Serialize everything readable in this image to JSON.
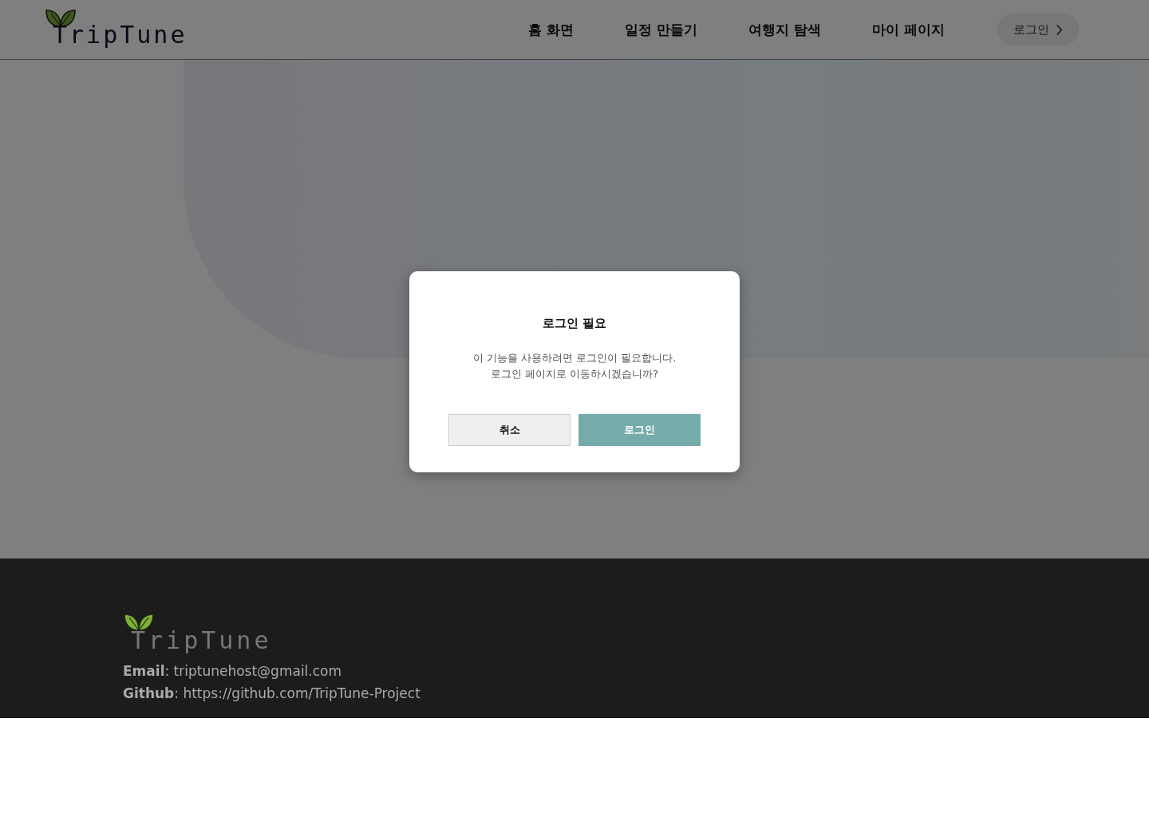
{
  "header": {
    "logo": "TripTune",
    "nav": [
      "홈 화면",
      "일정 만들기",
      "여행지 탐색",
      "마이 페이지"
    ],
    "login_button": "로그인"
  },
  "dialog": {
    "title": "로그인 필요",
    "message": "이 기능을 사용하려면 로그인이 필요합니다.\n로그인 페이지로 이동하시겠습니까?",
    "buttons": [
      {
        "label": "취소",
        "kind": "secondary"
      },
      {
        "label": "로그인",
        "kind": "primary"
      }
    ]
  },
  "footer": {
    "logo": "TripTune",
    "lines": [
      "**Email**: triptunehost@gmail.com",
      "**Github**: https://github.com/TripTune-Project"
    ]
  }
}
